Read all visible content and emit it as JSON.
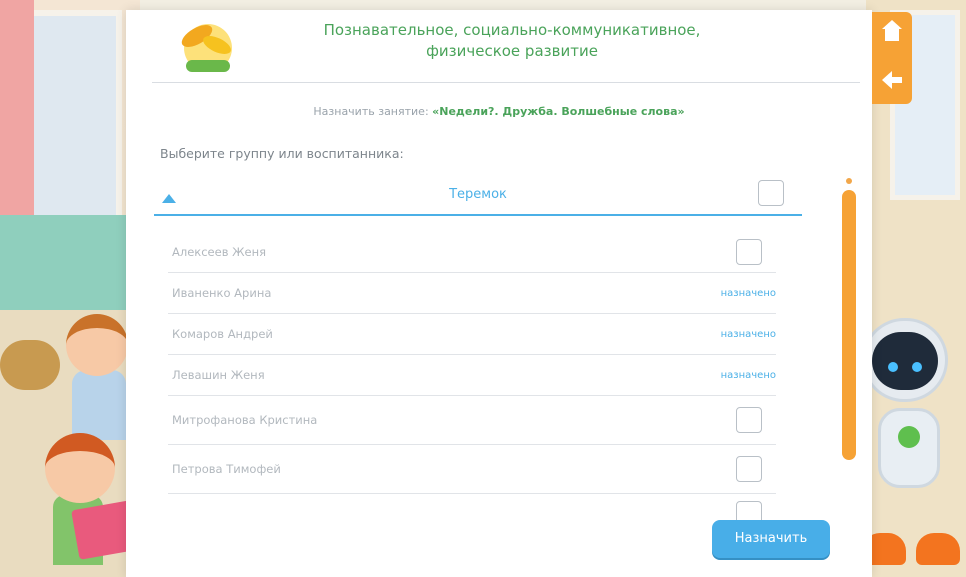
{
  "header": {
    "title_line1": "Познавательное, социально-коммуникативное,",
    "title_line2": "физическое развитие"
  },
  "assignment": {
    "prefix": "Назначить занятие:",
    "lesson": "«Neдели?. Дружба. Волшебные слова»"
  },
  "choose_label": "Выберите группу или воспитанника:",
  "group": {
    "name": "Теремок"
  },
  "children": [
    {
      "name": "Алексеев Женя",
      "status": ""
    },
    {
      "name": "Иваненко Арина",
      "status": "назначено"
    },
    {
      "name": "Комаров Андрей",
      "status": "назначено"
    },
    {
      "name": "Левашин Женя",
      "status": "назначено"
    },
    {
      "name": "Митрофанова Кристина",
      "status": ""
    },
    {
      "name": "Петрова Тимофей",
      "status": ""
    },
    {
      "name": "",
      "status": ""
    }
  ],
  "buttons": {
    "assign": "Назначить"
  },
  "icons": {
    "home": "home-icon",
    "back": "arrow-left-icon",
    "expand": "triangle-up-icon"
  },
  "colors": {
    "accent_blue": "#48aee8",
    "accent_orange": "#f6a235",
    "title_green": "#4aa35a"
  }
}
